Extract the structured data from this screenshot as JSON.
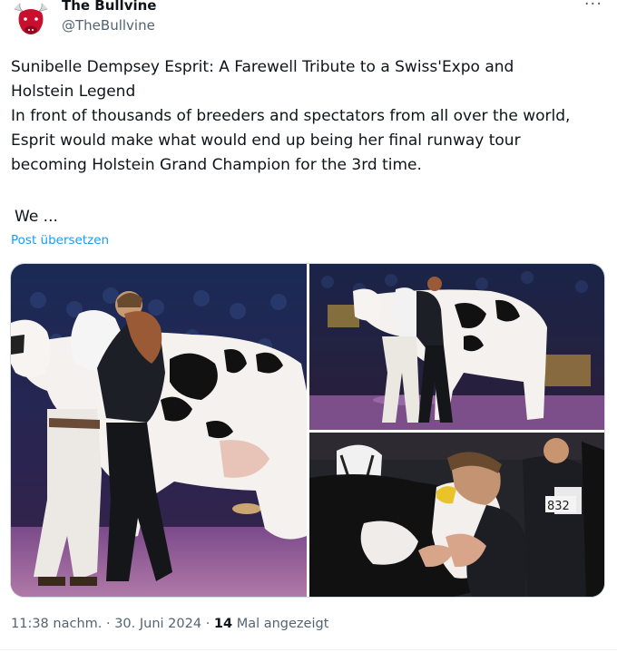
{
  "author": {
    "display_name": "The Bullvine",
    "handle": "@TheBullvine",
    "avatar_icon": "bull-head-logo"
  },
  "more_icon": "···",
  "tweet": {
    "lines": [
      "Sunibelle Dempsey Esprit: A Farewell Tribute to a Swiss'Expo and",
      "Holstein Legend",
      "In front of thousands of breeders and spectators from all over the world,",
      "Esprit would make what would end up being her final runway tour",
      "becoming Holstein Grand Champion for the 3rd time."
    ],
    "truncated": "We  ...",
    "translate_link": "Post übersetzen"
  },
  "media": {
    "photos": [
      "photo-handlers-embrace-cow",
      "photo-arena-wide-shot",
      "photo-cow-closeup-hug"
    ],
    "overlay_text": "832"
  },
  "meta": {
    "time": "11:38 nachm.",
    "separator": "·",
    "date": "30. Juni 2024",
    "views_count": "14",
    "views_label": "Mal angezeigt"
  },
  "colors": {
    "text": "#0f1419",
    "secondary": "#536471",
    "link": "#1d9bf0",
    "border": "#cfd9de"
  }
}
